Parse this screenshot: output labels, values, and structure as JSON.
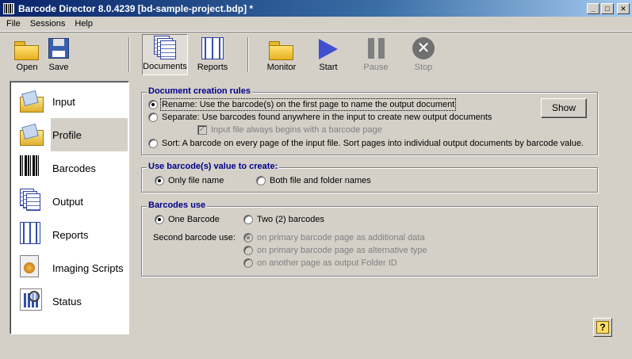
{
  "window": {
    "title": "Barcode Director  8.0.4239  [bd-sample-project.bdp] *",
    "minimize_glyph": "_",
    "maximize_glyph": "□",
    "close_glyph": "✕"
  },
  "menu": [
    "File",
    "Sessions",
    "Help"
  ],
  "toolbar": {
    "open": "Open",
    "save": "Save",
    "documents": "Documents",
    "reports": "Reports",
    "monitor": "Monitor",
    "start": "Start",
    "pause": "Pause",
    "stop": "Stop",
    "stop_glyph": "✕"
  },
  "sidebar": {
    "items": [
      {
        "label": "Input",
        "icon": "folder-open-icon"
      },
      {
        "label": "Profile",
        "icon": "folder-profile-icon",
        "selected": true
      },
      {
        "label": "Barcodes",
        "icon": "barcode-icon"
      },
      {
        "label": "Output",
        "icon": "documents-icon"
      },
      {
        "label": "Reports",
        "icon": "reports-icon"
      },
      {
        "label": "Imaging Scripts",
        "icon": "script-icon"
      },
      {
        "label": "Status",
        "icon": "status-chart-icon"
      }
    ]
  },
  "doc_rules": {
    "title": "Document creation rules",
    "rename": "Rename:  Use the barcode(s) on the first page to name the output document",
    "separate": "Separate: Use barcodes found anywhere in the input to create new output documents",
    "input_begins": "Input file always begins with a barcode page",
    "check_glyph": "✓",
    "sort": "Sort:  A barcode on every page of the input file.   Sort pages into individual output documents by  barcode value.",
    "show_button": "Show"
  },
  "use_value": {
    "title": "Use barcode(s) value to create:",
    "only_file": "Only file name",
    "both": "Both file and folder names"
  },
  "barcodes_use": {
    "title": "Barcodes  use",
    "one": "One Barcode",
    "two": "Two (2) barcodes",
    "second_label": "Second barcode use:",
    "opt1": "on primary barcode page as additional data",
    "opt2": "on primary barcode page as alternative type",
    "opt3": "on another page as output Folder ID"
  },
  "help_glyph": "?"
}
